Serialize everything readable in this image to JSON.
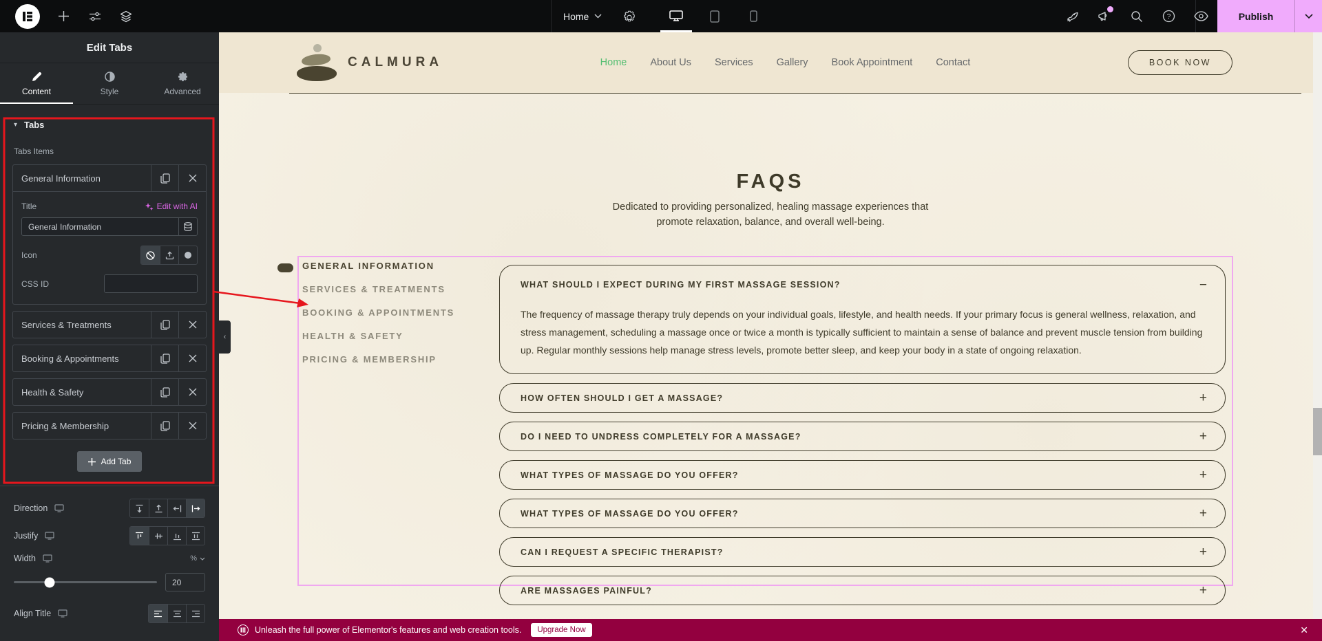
{
  "topbar": {
    "page_menu": "Home",
    "publish": "Publish"
  },
  "panel": {
    "title": "Edit Tabs",
    "tabs": {
      "content": "Content",
      "style": "Style",
      "advanced": "Advanced"
    },
    "section": "Tabs",
    "items_label": "Tabs Items",
    "item_controls": {
      "title_label": "Title",
      "edit_with_ai": "Edit with AI",
      "title_value": "General Information",
      "icon_label": "Icon",
      "css_id_label": "CSS ID",
      "css_id_value": ""
    },
    "items": [
      {
        "label": "General Information"
      },
      {
        "label": "Services & Treatments"
      },
      {
        "label": "Booking & Appointments"
      },
      {
        "label": "Health & Safety"
      },
      {
        "label": "Pricing & Membership"
      }
    ],
    "add_tab": "Add Tab",
    "layout": {
      "direction_label": "Direction",
      "justify_label": "Justify",
      "width_label": "Width",
      "width_unit": "%",
      "width_value": "20",
      "align_title_label": "Align Title"
    }
  },
  "site": {
    "brand": "CALMURA",
    "nav": [
      {
        "label": "Home"
      },
      {
        "label": "About Us"
      },
      {
        "label": "Services"
      },
      {
        "label": "Gallery"
      },
      {
        "label": "Book Appointment"
      },
      {
        "label": "Contact"
      }
    ],
    "book_now": "BOOK NOW",
    "faq": {
      "title": "FAQS",
      "subtitle_line1": "Dedicated to providing personalized, healing massage experiences that",
      "subtitle_line2": "promote relaxation, balance, and overall well-being.",
      "tabs": [
        {
          "label": "GENERAL INFORMATION"
        },
        {
          "label": "SERVICES & TREATMENTS"
        },
        {
          "label": "BOOKING & APPOINTMENTS"
        },
        {
          "label": "HEALTH & SAFETY"
        },
        {
          "label": "PRICING & MEMBERSHIP"
        }
      ],
      "items": [
        {
          "question": "WHAT SHOULD I EXPECT DURING MY FIRST MASSAGE SESSION?",
          "answer": "The frequency of massage therapy truly depends on your individual goals, lifestyle, and health needs. If your primary focus is general wellness, relaxation, and stress management, scheduling a massage once or twice a month is typically sufficient to maintain a sense of balance and prevent muscle tension from building up. Regular monthly sessions help manage stress levels, promote better sleep, and keep your body in a state of ongoing relaxation.",
          "state": "expanded"
        },
        {
          "question": "HOW OFTEN SHOULD I GET A MASSAGE?",
          "state": "collapsed"
        },
        {
          "question": "DO I NEED TO UNDRESS COMPLETELY FOR A MASSAGE?",
          "state": "collapsed"
        },
        {
          "question": "WHAT TYPES OF MASSAGE DO YOU OFFER?",
          "state": "collapsed"
        },
        {
          "question": "WHAT TYPES OF MASSAGE DO YOU OFFER?",
          "state": "collapsed"
        },
        {
          "question": "CAN I REQUEST A SPECIFIC THERAPIST?",
          "state": "collapsed"
        },
        {
          "question": "ARE MASSAGES PAINFUL?",
          "state": "collapsed"
        }
      ]
    }
  },
  "banner": {
    "message": "Unleash the full power of Elementor's features and web creation tools.",
    "cta": "Upgrade Now"
  },
  "colors": {
    "publish_pink": "#F0ABFC",
    "ai_pink": "#DB66E6",
    "banner_magenta": "#93003F",
    "selection_outline": "#F0A8F0",
    "annotation_red": "#E6161D",
    "nav_active_green": "#53BE71",
    "site_text": "#3F3B2A",
    "canvas_beige": "#F5F0E3",
    "header_beige": "#EFE6D2"
  }
}
